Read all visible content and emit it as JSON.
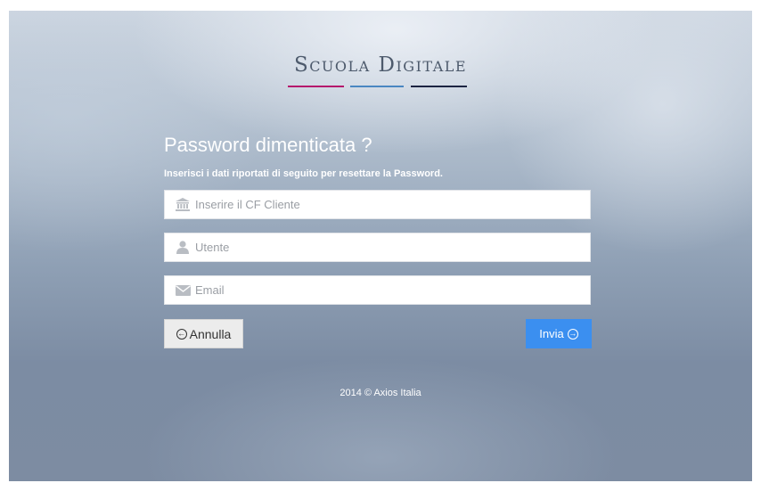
{
  "logo": {
    "text": "Scuola Digitale"
  },
  "form": {
    "title": "Password dimenticata ?",
    "subtitle": "Inserisci i dati riportati di seguito per resettare la Password.",
    "fields": [
      {
        "icon": "bank-icon",
        "placeholder": "Inserire il CF Cliente",
        "value": ""
      },
      {
        "icon": "user-icon",
        "placeholder": "Utente",
        "value": ""
      },
      {
        "icon": "envelope-icon",
        "placeholder": "Email",
        "value": ""
      }
    ],
    "cancel_label": "Annulla",
    "submit_label": "Invia"
  },
  "footer": {
    "text": "2014 © Axios Italia"
  },
  "colors": {
    "logo_pink": "#b5176c",
    "logo_blue": "#4a87c2",
    "logo_navy": "#1c2442",
    "submit_button": "#3b8ff0"
  }
}
